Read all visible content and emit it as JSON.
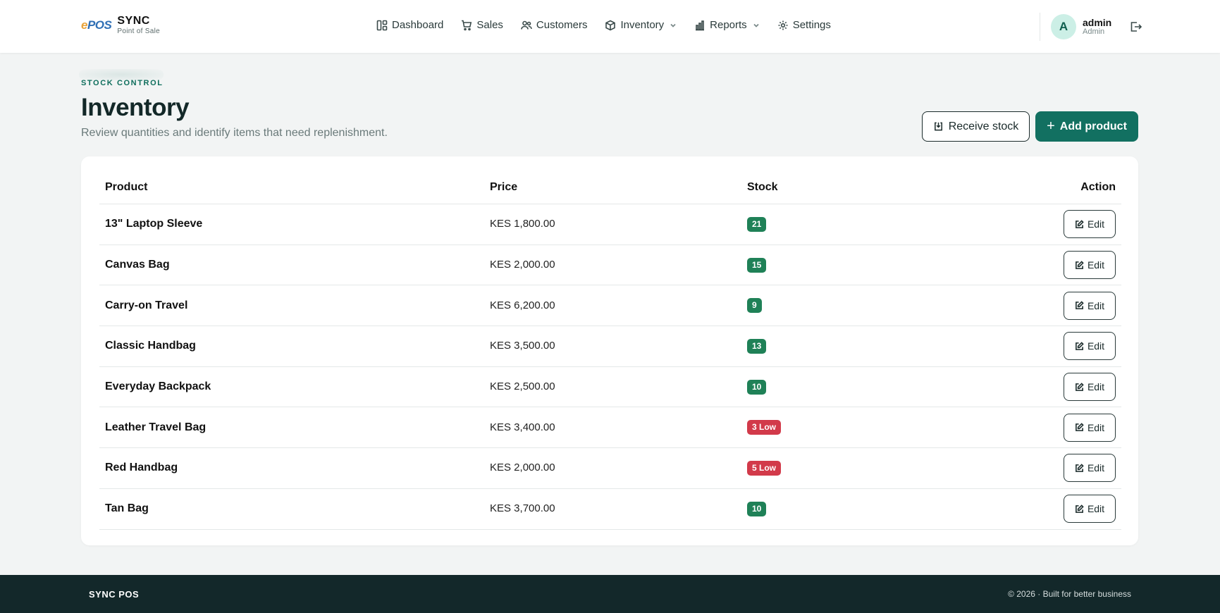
{
  "brand": {
    "logo_part1": "e",
    "logo_part2": "POS",
    "name": "SYNC",
    "subtitle": "Point of Sale"
  },
  "nav": {
    "items": [
      {
        "label": "Dashboard",
        "icon": "dashboard-icon"
      },
      {
        "label": "Sales",
        "icon": "cart-icon"
      },
      {
        "label": "Customers",
        "icon": "users-icon"
      },
      {
        "label": "Inventory",
        "icon": "box-icon",
        "dropdown": true
      },
      {
        "label": "Reports",
        "icon": "bar-chart-icon",
        "dropdown": true
      },
      {
        "label": "Settings",
        "icon": "gear-icon"
      }
    ]
  },
  "user": {
    "initial": "A",
    "name": "admin",
    "role": "Admin"
  },
  "page": {
    "eyebrow": "STOCK CONTROL",
    "title": "Inventory",
    "subtitle": "Review quantities and identify items that need replenishment.",
    "receive_label": "Receive stock",
    "add_label": "Add product"
  },
  "table": {
    "headers": {
      "product": "Product",
      "price": "Price",
      "stock": "Stock",
      "action": "Action"
    },
    "rows": [
      {
        "product": "13\" Laptop Sleeve",
        "price": "KES 1,800.00",
        "stock": "21",
        "low": false,
        "action": "Edit"
      },
      {
        "product": "Canvas Bag",
        "price": "KES 2,000.00",
        "stock": "15",
        "low": false,
        "action": "Edit"
      },
      {
        "product": "Carry-on Travel",
        "price": "KES 6,200.00",
        "stock": "9",
        "low": false,
        "action": "Edit"
      },
      {
        "product": "Classic Handbag",
        "price": "KES 3,500.00",
        "stock": "13",
        "low": false,
        "action": "Edit"
      },
      {
        "product": "Everyday Backpack",
        "price": "KES 2,500.00",
        "stock": "10",
        "low": false,
        "action": "Edit"
      },
      {
        "product": "Leather Travel Bag",
        "price": "KES 3,400.00",
        "stock": "3 Low",
        "low": true,
        "action": "Edit"
      },
      {
        "product": "Red Handbag",
        "price": "KES 2,000.00",
        "stock": "5 Low",
        "low": true,
        "action": "Edit"
      },
      {
        "product": "Tan Bag",
        "price": "KES 3,700.00",
        "stock": "10",
        "low": false,
        "action": "Edit"
      }
    ]
  },
  "footer": {
    "brand": "SYNC POS",
    "copyright": "© 2026 · Built for better business"
  },
  "colors": {
    "accent": "#127061",
    "ok": "#1f8157",
    "low": "#d23a4a",
    "footer_bg": "#13282a"
  }
}
